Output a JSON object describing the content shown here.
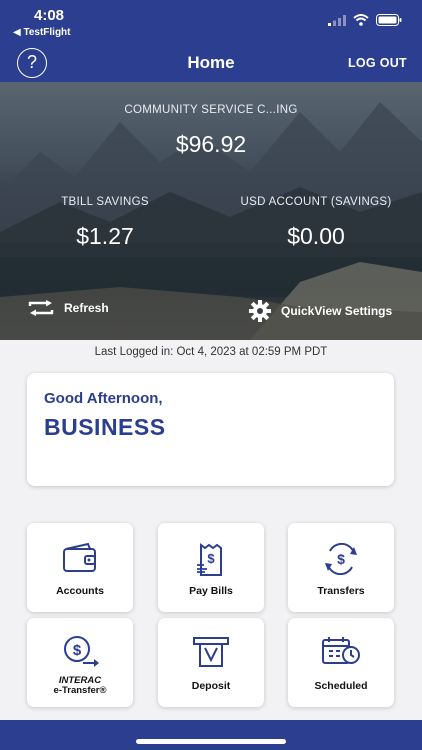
{
  "status_bar": {
    "time": "4:08",
    "back_app": "◀ TestFlight"
  },
  "nav": {
    "title": "Home",
    "logout_label": "LOG OUT",
    "help_glyph": "?"
  },
  "accounts": {
    "primary": {
      "name": "COMMUNITY SERVICE C...ING",
      "balance": "$96.92"
    },
    "left": {
      "name": "TBILL SAVINGS",
      "balance": "$1.27"
    },
    "right": {
      "name": "USD ACCOUNT (SAVINGS)",
      "balance": "$0.00"
    }
  },
  "actions": {
    "refresh_label": "Refresh",
    "quickview_label": "QuickView Settings"
  },
  "last_logged": "Last Logged in: Oct 4, 2023 at 02:59 PM  PDT",
  "greeting": {
    "salutation": "Good Afternoon,",
    "user": "BUSINESS"
  },
  "tiles": {
    "accounts": "Accounts",
    "pay_bills": "Pay Bills",
    "transfers": "Transfers",
    "interac_brand": "INTERAC",
    "interac_rest": "e-Transfer®",
    "deposit": "Deposit",
    "scheduled": "Scheduled"
  },
  "colors": {
    "brand_blue": "#2c3e8f",
    "background": "#f2f2f4",
    "tile_bg": "#ffffff"
  },
  "icons": [
    "help-icon",
    "refresh-icon",
    "gear-icon",
    "wallet-icon",
    "receipt-dollar-icon",
    "exchange-dollar-icon",
    "dollar-send-icon",
    "atm-deposit-icon",
    "calendar-clock-icon"
  ]
}
